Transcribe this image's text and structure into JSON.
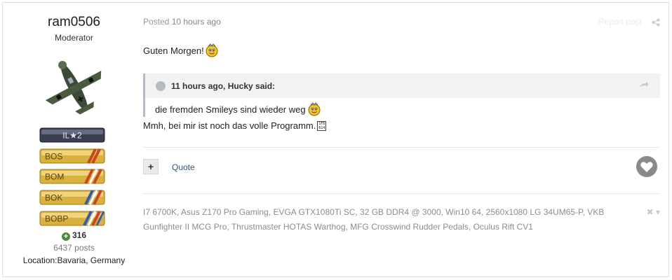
{
  "author": {
    "username": "ram0506",
    "group": "Moderator",
    "badges": [
      "IL★2",
      "BOS",
      "BOM",
      "BOK",
      "BOBP"
    ],
    "reputation": "316",
    "posts": "6437 posts",
    "location": "Location:Bavaria, Germany"
  },
  "post": {
    "posted_prefix": "Posted",
    "posted_time": "10 hours ago",
    "report_label": "Report post",
    "greeting": "Guten Morgen!",
    "reply": "Mmh, bei mir ist noch das volle Programm.",
    "unicode_box": "1F6 614"
  },
  "quote": {
    "header": "11 hours ago, Hucky said:",
    "body": "die fremden Smileys sind wieder weg"
  },
  "actions": {
    "quote_label": "Quote"
  },
  "signature": {
    "text": "I7 6700K, Asus Z170 Pro Gaming, EVGA GTX1080Ti SC, 32 GB DDR4 @ 3000, Win10 64, 2560x1080 LG 34UM65-P, VKB Gunfighter II MCG Pro, Thrustmaster HOTAS Warthog, MFG Crosswind Rudder Pedals, Oculus Rift CV1"
  },
  "colors": {
    "accent": "#36557a",
    "badge_gold": "#d9b13d",
    "rep_green": "#4e8a3a"
  },
  "icons": [
    "avatar-plane",
    "smiley-icon",
    "share-icon",
    "quote-circle-icon",
    "reply-arrow-icon",
    "plus-icon",
    "like-heart-icon",
    "signature-close-icon"
  ]
}
